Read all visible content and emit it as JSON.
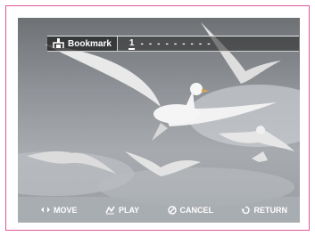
{
  "bookmark": {
    "title": "Bookmark",
    "current_slot": "1",
    "empty_slots": [
      "-",
      "-",
      "-",
      "-",
      "-",
      "-",
      "-",
      "-",
      "-"
    ]
  },
  "controls": [
    {
      "icon": "left-right-arrows-icon",
      "label": "MOVE"
    },
    {
      "icon": "play-icon",
      "label": "PLAY"
    },
    {
      "icon": "cancel-icon",
      "label": "CANCEL"
    },
    {
      "icon": "return-icon",
      "label": "RETURN"
    }
  ],
  "colors": {
    "frame_border": "#e0569a",
    "overlay_text": "#ffffff"
  }
}
